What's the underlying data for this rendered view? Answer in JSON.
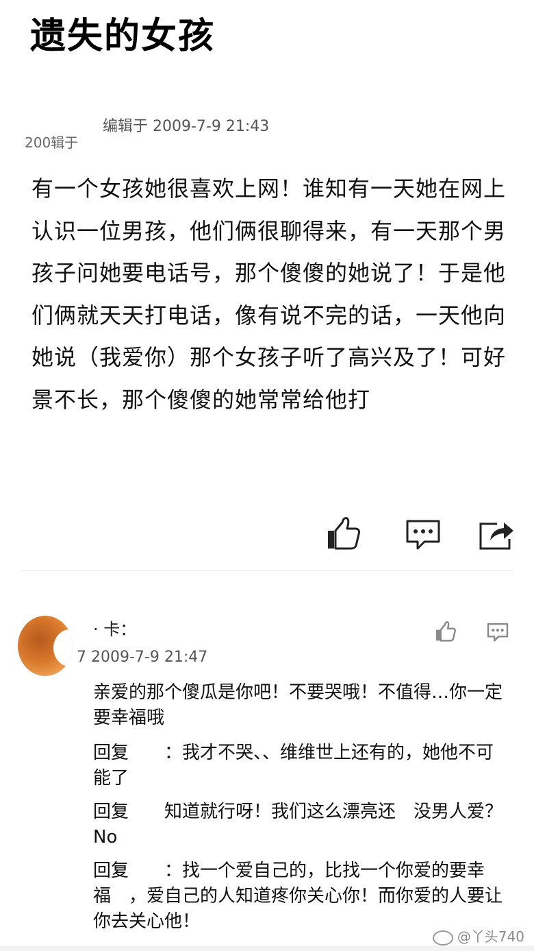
{
  "post": {
    "title": "遗失的女孩",
    "edited": "编辑于 2009-7-9 21:43",
    "edited_faint": "200辑于",
    "body": "有一个女孩她很喜欢上网！谁知有一天她在网上认识一位男孩，他们俩很聊得来，有一天那个男孩子问她要电话号，那个傻傻的她说了！于是他们俩就天天打电话，像有说不完的话，一天他向她说（我爱你）那个女孩子听了高兴及了！可好景不长，那个傻傻的她常常给他打"
  },
  "actions": {
    "like_icon": "thumbs-up-icon",
    "comment_icon": "comment-icon",
    "share_icon": "share-icon"
  },
  "comment": {
    "user": "· 卡：",
    "time": "7 2009-7-9 21:47",
    "text": "亲爱的那个傻瓜是你吧！不要哭哦！不值得…你一定要幸福哦",
    "replies": [
      "回复　　：我才不哭、、维维世上还有的，她他不可能了",
      "回复　　知道就行呀！我们这么漂亮还　没男人爱？No",
      "回复　　：找一个爱自己的，比找一个你爱的要幸福　，爱自己的人知道疼你关心你！而你爱的人要让你去关心他！"
    ]
  },
  "watermark": "@丫头740",
  "colors": {
    "accent": "#d9782c",
    "text": "#111111",
    "meta": "#555555"
  }
}
